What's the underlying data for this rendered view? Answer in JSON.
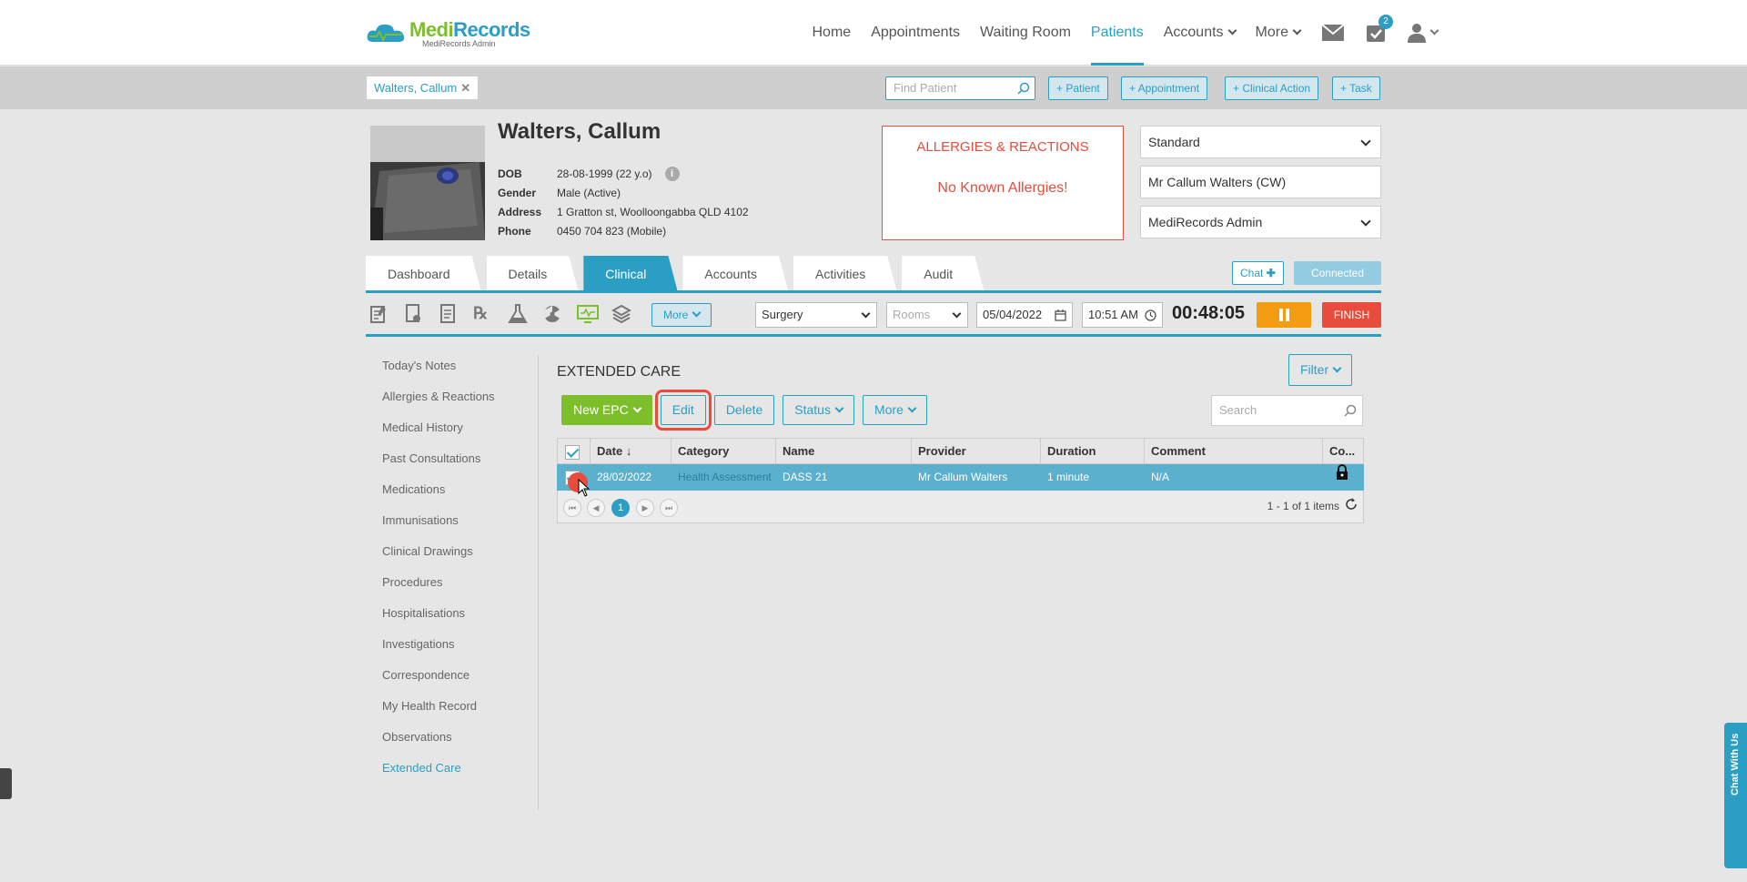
{
  "app": {
    "logo_name_part1": "Medi",
    "logo_name_part2": "Records",
    "logo_subtitle": "MediRecords Admin"
  },
  "nav": {
    "items": [
      {
        "label": "Home"
      },
      {
        "label": "Appointments"
      },
      {
        "label": "Waiting Room"
      },
      {
        "label": "Patients",
        "active": true
      },
      {
        "label": "Accounts"
      },
      {
        "label": "More"
      }
    ],
    "tasks_badge": "2"
  },
  "patient_bar": {
    "open_tab": "Walters, Callum",
    "find_placeholder": "Find Patient",
    "actions": [
      "+ Patient",
      "+ Appointment",
      "+ Clinical Action",
      "+ Task"
    ]
  },
  "patient": {
    "name": "Walters, Callum",
    "dob_label": "DOB",
    "dob": "28-08-1999 (22 y.o)",
    "gender_label": "Gender",
    "gender": "Male (Active)",
    "address_label": "Address",
    "address": "1 Gratton st, Woolloongabba QLD 4102",
    "phone_label": "Phone",
    "phone": "0450 704 823 (Mobile)"
  },
  "allergies": {
    "title": "ALLERGIES & REACTIONS",
    "value": "No Known Allergies!"
  },
  "selectors": {
    "billing": "Standard",
    "provider": "Mr Callum Walters (CW)",
    "practice": "MediRecords Admin"
  },
  "tabs": [
    {
      "label": "Dashboard"
    },
    {
      "label": "Details"
    },
    {
      "label": "Clinical",
      "active": true
    },
    {
      "label": "Accounts"
    },
    {
      "label": "Activities"
    },
    {
      "label": "Audit"
    }
  ],
  "chat": {
    "button": "Chat",
    "status": "Connected"
  },
  "toolbar": {
    "more_label": "More",
    "location": "Surgery",
    "rooms_placeholder": "Rooms",
    "date": "05/04/2022",
    "time": "10:51 AM",
    "timer": "00:48:05",
    "finish_label": "FINISH"
  },
  "sidenav": [
    "Today's Notes",
    "Allergies & Reactions",
    "Medical History",
    "Past Consultations",
    "Medications",
    "Immunisations",
    "Clinical Drawings",
    "Procedures",
    "Hospitalisations",
    "Investigations",
    "Correspondence",
    "My Health Record",
    "Observations",
    "Extended Care"
  ],
  "sidenav_active": "Extended Care",
  "content": {
    "title": "EXTENDED CARE",
    "filter_label": "Filter",
    "buttons": {
      "new_epc": "New EPC",
      "edit": "Edit",
      "delete": "Delete",
      "status": "Status",
      "more": "More"
    },
    "search_placeholder": "Search"
  },
  "grid": {
    "columns": [
      "Date",
      "Category",
      "Name",
      "Provider",
      "Duration",
      "Comment",
      "Co..."
    ],
    "rows": [
      {
        "date": "28/02/2022",
        "category": "Health Assessment",
        "name": "DASS 21",
        "provider": "Mr Callum Walters",
        "duration": "1 minute",
        "comment": "N/A"
      }
    ],
    "current_page": "1",
    "items_summary": "1 - 1 of 1 items"
  },
  "chat_widget": {
    "label": "Chat With Us"
  },
  "colors": {
    "accent": "#2b9ec4",
    "brand_green": "#7cbf2b",
    "danger": "#e74c3c",
    "pause": "#f39c12",
    "selected_row": "#5bb1cd"
  }
}
